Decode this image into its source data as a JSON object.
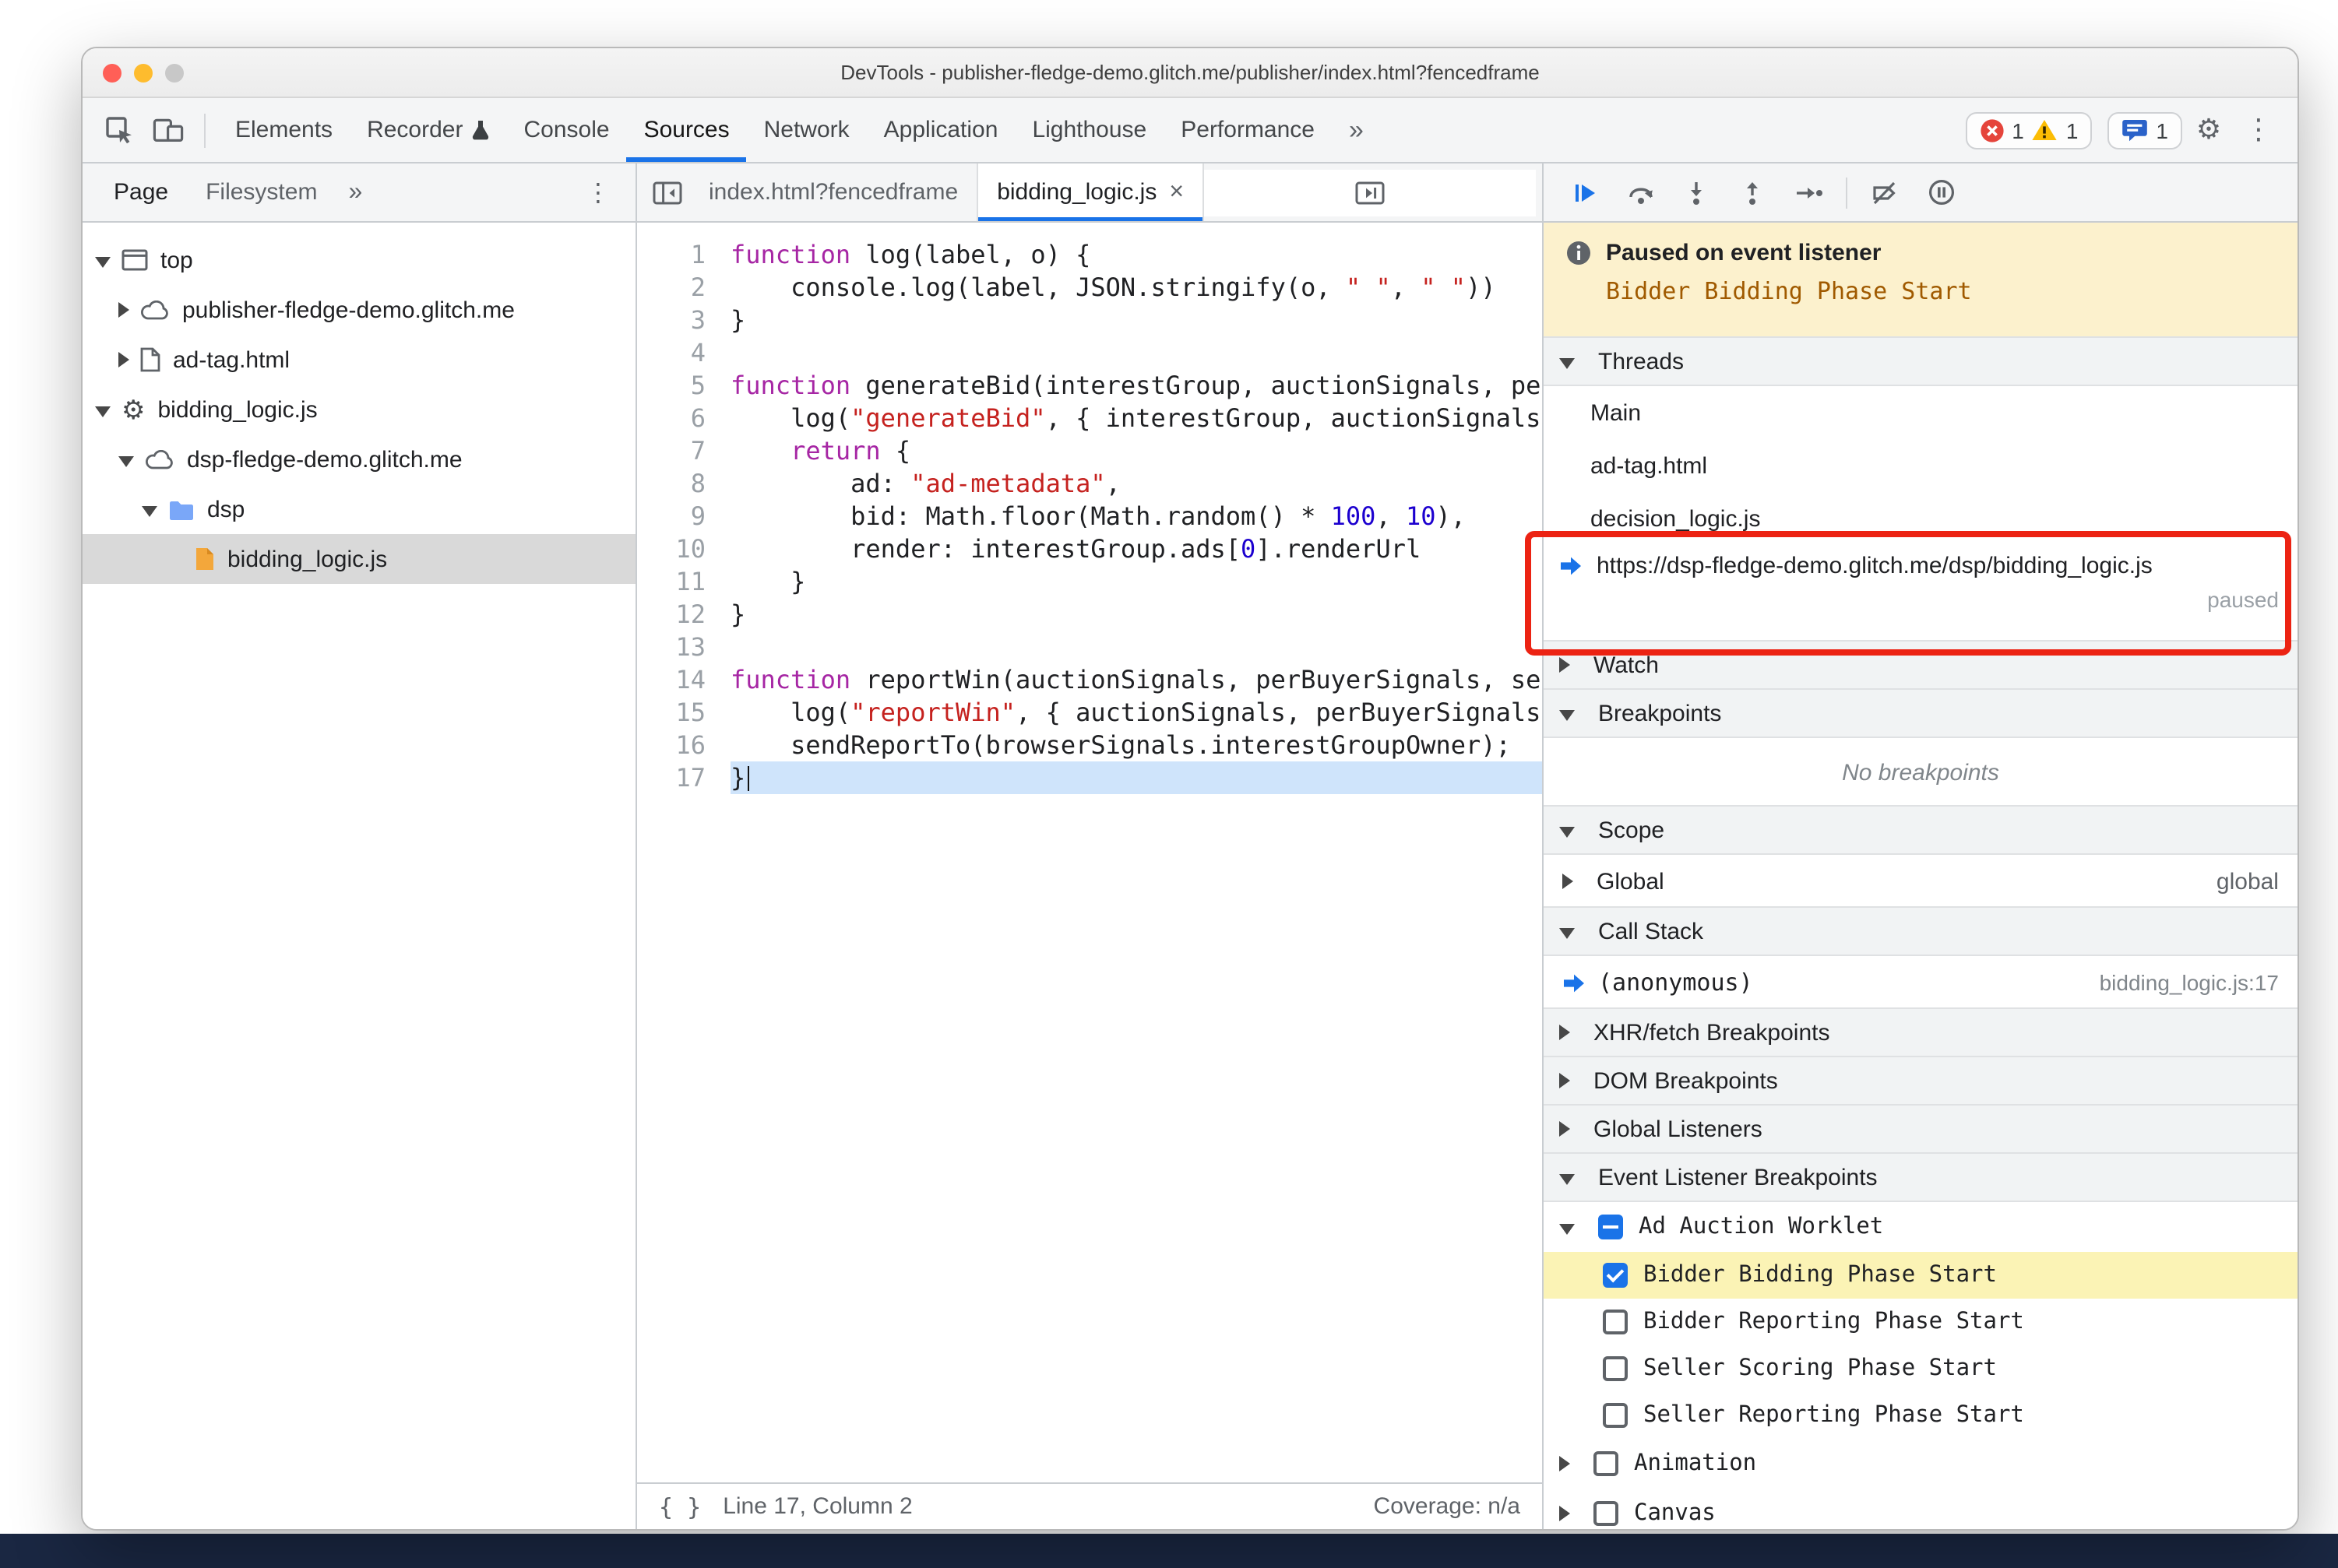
{
  "window": {
    "title": "DevTools - publisher-fledge-demo.glitch.me/publisher/index.html?fencedframe"
  },
  "icons": {
    "more_tabs": "»",
    "kebab": "⋮",
    "gear_glyph": "⚙",
    "close": "×",
    "format_braces": "{ }"
  },
  "toolbar": {
    "tabs": [
      {
        "label": "Elements"
      },
      {
        "label": "Recorder",
        "badge": "experiment-flask-icon"
      },
      {
        "label": "Console"
      },
      {
        "label": "Sources",
        "active": true
      },
      {
        "label": "Network"
      },
      {
        "label": "Application"
      },
      {
        "label": "Lighthouse"
      },
      {
        "label": "Performance"
      }
    ],
    "error_count": "1",
    "warning_count": "1",
    "issues_count": "1"
  },
  "navigator": {
    "tabs": [
      {
        "label": "Page",
        "active": true
      },
      {
        "label": "Filesystem",
        "active": false
      }
    ],
    "tree": [
      {
        "label": "top",
        "icon": "frame",
        "expand": "open",
        "depth": 0
      },
      {
        "label": "publisher-fledge-demo.glitch.me",
        "icon": "cloud",
        "expand": "closed",
        "depth": 1
      },
      {
        "label": "ad-tag.html",
        "icon": "document",
        "expand": "closed",
        "depth": 1
      },
      {
        "label": "bidding_logic.js",
        "icon": "gear",
        "expand": "open",
        "depth": 0
      },
      {
        "label": "dsp-fledge-demo.glitch.me",
        "icon": "cloud",
        "expand": "open",
        "depth": 1
      },
      {
        "label": "dsp",
        "icon": "folder",
        "expand": "open",
        "depth": 2
      },
      {
        "label": "bidding_logic.js",
        "icon": "file-script",
        "expand": "none",
        "depth": 3,
        "selected": true
      }
    ]
  },
  "editor": {
    "tabs": [
      {
        "label": "index.html?fencedframe"
      },
      {
        "label": "bidding_logic.js",
        "active": true,
        "closable": true
      }
    ],
    "status": {
      "line_col": "Line 17, Column 2",
      "coverage": "Coverage: n/a"
    },
    "code_lines": [
      {
        "n": 1,
        "tokens": [
          [
            "kw",
            "function"
          ],
          [
            "pl",
            " log(label, o) {"
          ]
        ]
      },
      {
        "n": 2,
        "tokens": [
          [
            "pl",
            "    console.log(label, JSON.stringify(o, "
          ],
          [
            "str",
            "\" \""
          ],
          [
            "pl",
            ", "
          ],
          [
            "str",
            "\" \""
          ],
          [
            "pl",
            "))"
          ]
        ]
      },
      {
        "n": 3,
        "tokens": [
          [
            "pl",
            "}"
          ]
        ]
      },
      {
        "n": 4,
        "tokens": []
      },
      {
        "n": 5,
        "tokens": [
          [
            "kw",
            "function"
          ],
          [
            "pl",
            " generateBid(interestGroup, auctionSignals, perBuyerSignals, trustedBiddingSignals, browserSignals) {"
          ]
        ]
      },
      {
        "n": 6,
        "tokens": [
          [
            "pl",
            "    log("
          ],
          [
            "str",
            "\"generateBid\""
          ],
          [
            "pl",
            ", { interestGroup, auctionSignals, perBuyerSignals, browserSignals });"
          ]
        ]
      },
      {
        "n": 7,
        "tokens": [
          [
            "pl",
            "    "
          ],
          [
            "kw",
            "return"
          ],
          [
            "pl",
            " {"
          ]
        ]
      },
      {
        "n": 8,
        "tokens": [
          [
            "pl",
            "        ad: "
          ],
          [
            "str",
            "\"ad-metadata\""
          ],
          [
            "pl",
            ","
          ]
        ]
      },
      {
        "n": 9,
        "tokens": [
          [
            "pl",
            "        bid: Math.floor(Math.random() * "
          ],
          [
            "num",
            "100"
          ],
          [
            "pl",
            ", "
          ],
          [
            "num",
            "10"
          ],
          [
            "pl",
            "),"
          ]
        ]
      },
      {
        "n": 10,
        "tokens": [
          [
            "pl",
            "        render: interestGroup.ads["
          ],
          [
            "num",
            "0"
          ],
          [
            "pl",
            "].renderUrl"
          ]
        ]
      },
      {
        "n": 11,
        "tokens": [
          [
            "pl",
            "    }"
          ]
        ]
      },
      {
        "n": 12,
        "tokens": [
          [
            "pl",
            "}"
          ]
        ]
      },
      {
        "n": 13,
        "tokens": []
      },
      {
        "n": 14,
        "tokens": [
          [
            "kw",
            "function"
          ],
          [
            "pl",
            " reportWin(auctionSignals, perBuyerSignals, sellerSignals, browserSignals) {"
          ]
        ]
      },
      {
        "n": 15,
        "tokens": [
          [
            "pl",
            "    log("
          ],
          [
            "str",
            "\"reportWin\""
          ],
          [
            "pl",
            ", { auctionSignals, perBuyerSignals, sellerSignals, browserSignals });"
          ]
        ]
      },
      {
        "n": 16,
        "tokens": [
          [
            "pl",
            "    sendReportTo(browserSignals.interestGroupOwner);"
          ]
        ]
      },
      {
        "n": 17,
        "tokens": [
          [
            "pl",
            "}"
          ]
        ],
        "exec": true,
        "caret": true
      }
    ]
  },
  "debugger": {
    "paused_banner": {
      "title": "Paused on event listener",
      "detail": "Bidder Bidding Phase Start"
    },
    "sections": {
      "threads": "Threads",
      "watch": "Watch",
      "breakpoints": "Breakpoints",
      "scope": "Scope",
      "call_stack": "Call Stack",
      "xhr": "XHR/fetch Breakpoints",
      "dom": "DOM Breakpoints",
      "global_listeners": "Global Listeners",
      "event_listener_breakpoints": "Event Listener Breakpoints"
    },
    "threads": [
      {
        "label": "Main"
      },
      {
        "label": "ad-tag.html"
      },
      {
        "label": "decision_logic.js"
      },
      {
        "label": "https://dsp-fledge-demo.glitch.me/dsp/bidding_logic.js",
        "active": true,
        "status": "paused"
      }
    ],
    "breakpoints_empty": "No breakpoints",
    "scope_rows": [
      {
        "label": "Global",
        "value": "global"
      }
    ],
    "call_stack_rows": [
      {
        "label": "(anonymous)",
        "location": "bidding_logic.js:17",
        "active": true
      }
    ],
    "event_listener_breakpoints": [
      {
        "label": "Ad Auction Worklet",
        "checkbox": "indeterminate",
        "expanded": true,
        "children": [
          {
            "label": "Bidder Bidding Phase Start",
            "checkbox": "checked",
            "highlighted": true
          },
          {
            "label": "Bidder Reporting Phase Start",
            "checkbox": "unchecked"
          },
          {
            "label": "Seller Scoring Phase Start",
            "checkbox": "unchecked"
          },
          {
            "label": "Seller Reporting Phase Start",
            "checkbox": "unchecked"
          }
        ]
      },
      {
        "label": "Animation",
        "checkbox": "unchecked",
        "expanded": false,
        "children": []
      },
      {
        "label": "Canvas",
        "checkbox": "unchecked",
        "expanded": false,
        "children": []
      }
    ]
  },
  "colors": {
    "accent": "#1a73e8",
    "annotation_red": "#ec2313",
    "paused_banner_bg": "#fcf1cd",
    "exec_line_bg": "#cfe4fb",
    "highlight_row_bg": "#fbf3b5"
  }
}
